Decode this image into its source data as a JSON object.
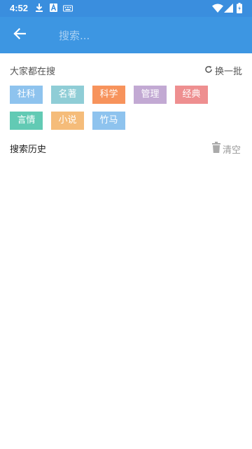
{
  "status_bar": {
    "time": "4:52",
    "icons": [
      "download-icon",
      "a-icon",
      "keyboard-icon",
      "wifi-icon",
      "signal-icon",
      "battery-icon"
    ]
  },
  "search": {
    "placeholder": "搜索..."
  },
  "hot": {
    "title": "大家都在搜",
    "refresh_label": "换一批",
    "tags": [
      {
        "label": "社科",
        "color": "#8ec3ee"
      },
      {
        "label": "名著",
        "color": "#8fcdd6"
      },
      {
        "label": "科学",
        "color": "#f7935c"
      },
      {
        "label": "管理",
        "color": "#c2a9d3"
      },
      {
        "label": "经典",
        "color": "#ee8f90"
      },
      {
        "label": "言情",
        "color": "#62cab4"
      },
      {
        "label": "小说",
        "color": "#f5bc7a"
      },
      {
        "label": "竹马",
        "color": "#8ec3ee"
      }
    ]
  },
  "history": {
    "title": "搜索历史",
    "clear_label": "清空"
  },
  "colors": {
    "status_bar": "#3a8ede",
    "app_bar": "#3d96e2"
  }
}
